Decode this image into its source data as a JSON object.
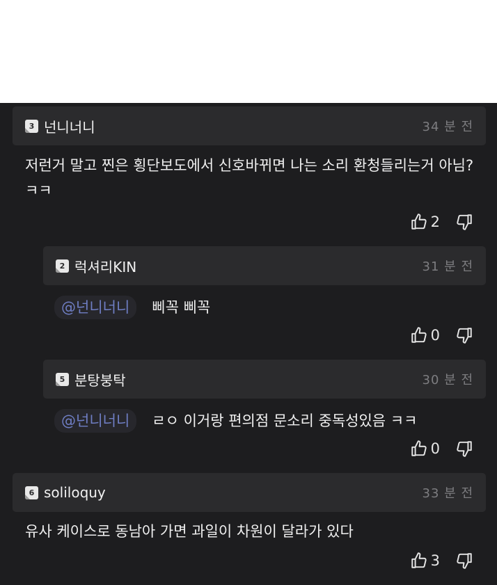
{
  "comments": [
    {
      "rank": "3",
      "author": "넌니너니",
      "time": "34 분 전",
      "text": "저런거 말고 찐은 횡단보도에서 신호바뀌면 나는 소리 환청들리는거 아님? ㅋㅋ",
      "likes": "2"
    },
    {
      "rank": "2",
      "author": "럭셔리KIN",
      "time": "31 분 전",
      "mention": "@넌니너니",
      "text": "삐꼭 삐꼭",
      "likes": "0"
    },
    {
      "rank": "5",
      "author": "분탕붕탁",
      "time": "30 분 전",
      "mention": "@넌니너니",
      "text": "ㄹㅇ 이거랑 편의점 문소리 중독성있음 ㅋㅋ",
      "likes": "0"
    },
    {
      "rank": "6",
      "author": "soliloquy",
      "time": "33 분 전",
      "text": "유사 케이스로 동남아 가면 과일이 차원이 달라가 있다",
      "likes": "3"
    }
  ],
  "icons": {
    "like": "thumbs-up-icon",
    "dislike": "thumbs-down-icon"
  }
}
